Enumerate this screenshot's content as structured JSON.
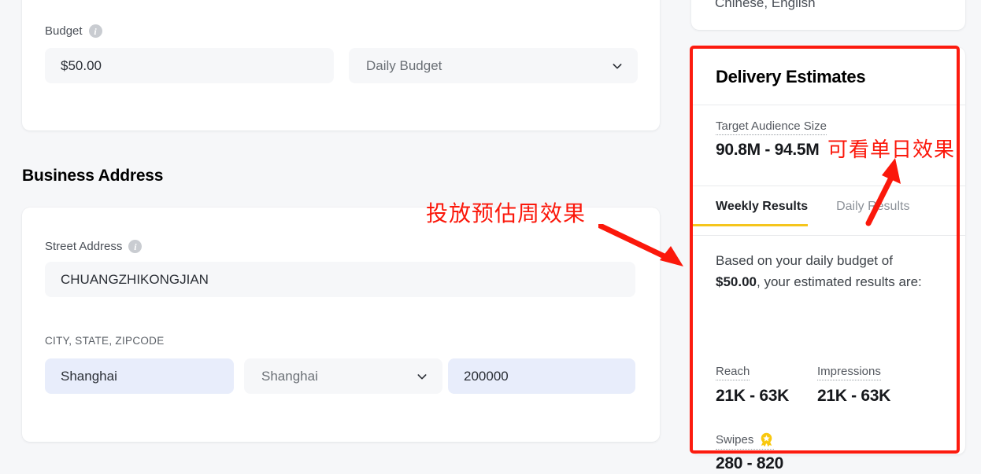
{
  "budget_card": {
    "label": "Budget",
    "info_icon": "info-icon",
    "amount": "$50.00",
    "budget_type": "Daily Budget",
    "chevron_icon": "chevron-down-icon"
  },
  "business_address": {
    "heading": "Business Address",
    "street_label": "Street Address",
    "street_value": "CHUANGZHIKONGJIAN",
    "city_state_zip_label": "CITY, STATE, ZIPCODE",
    "city_value": "Shanghai",
    "state_value": "Shanghai",
    "zip_value": "200000"
  },
  "languages_card": {
    "value": "Chinese, English"
  },
  "delivery_estimates": {
    "title": "Delivery Estimates",
    "target_audience_label": "Target Audience Size",
    "target_audience_value": "90.8M - 94.5M",
    "tabs": [
      {
        "label": "Weekly Results",
        "active": true
      },
      {
        "label": "Daily Results",
        "active": false
      }
    ],
    "estimate_intro_1": "Based on your daily budget of ",
    "estimate_budget": "$50.00",
    "estimate_intro_2": ", your estimated results are:",
    "metrics": [
      {
        "label": "Reach",
        "value": "21K - 63K"
      },
      {
        "label": "Impressions",
        "value": "21K - 63K"
      },
      {
        "label": "Swipes",
        "value": "280 - 820",
        "icon": "medal-award-icon"
      }
    ]
  },
  "annotations": {
    "note_weekly": "投放预估周效果",
    "note_daily": "可看单日效果",
    "highlight_color": "#fc1b0f",
    "accent_tab_color": "#f5c51c"
  }
}
